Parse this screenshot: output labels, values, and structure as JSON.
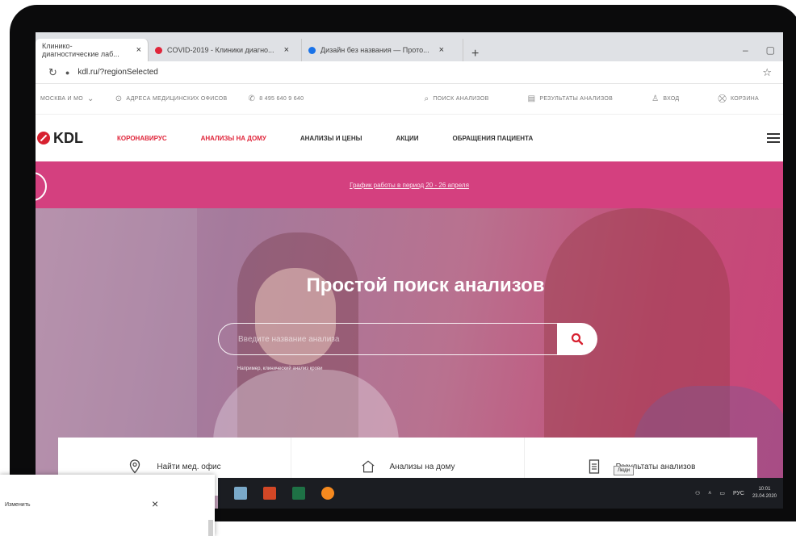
{
  "browser": {
    "tabs": [
      {
        "label": "Клинико-диагностические лаб..."
      },
      {
        "label": "COVID-2019 - Клиники диагно..."
      },
      {
        "label": "Дизайн без названия — Прото..."
      }
    ],
    "new_tab": "+",
    "url": "kdl.ru/?regionSelected"
  },
  "site": {
    "infobar": {
      "region": "Москва и МО",
      "addresses": "Адреса медицинских офисов",
      "phone": "8 495 640 9 640",
      "search_tests": "Поиск анализов",
      "results": "Результаты анализов",
      "login": "Вход",
      "cart": "Корзина"
    },
    "logo_text": "KDL",
    "nav": {
      "coronavirus": "КОРОНАВИРУС",
      "home_tests": "АНАЛИЗЫ НА ДОМУ",
      "tests_prices": "АНАЛИЗЫ И ЦЕНЫ",
      "promotions": "АКЦИИ",
      "patient_requests": "ОБРАЩЕНИЯ ПАЦИЕНТА"
    },
    "banner_text": "График работы в период 20 - 26 апреля",
    "hero": {
      "title": "Простой поиск анализов",
      "search_placeholder": "Введите название анализа",
      "example": "Например, клинический анализ крови"
    },
    "quick_links": {
      "find_office": "Найти мед. офис",
      "home_tests": "Анализы на дому",
      "results": "Результаты анализов"
    }
  },
  "taskbar": {
    "tooltip": "Люди",
    "lang": "РУС",
    "time": "10:01",
    "date": "23.04.2020"
  },
  "popup": {
    "title": "Изменить",
    "close": "×"
  },
  "colors": {
    "brand_red": "#e0263b",
    "banner_pink": "#d4407f"
  }
}
